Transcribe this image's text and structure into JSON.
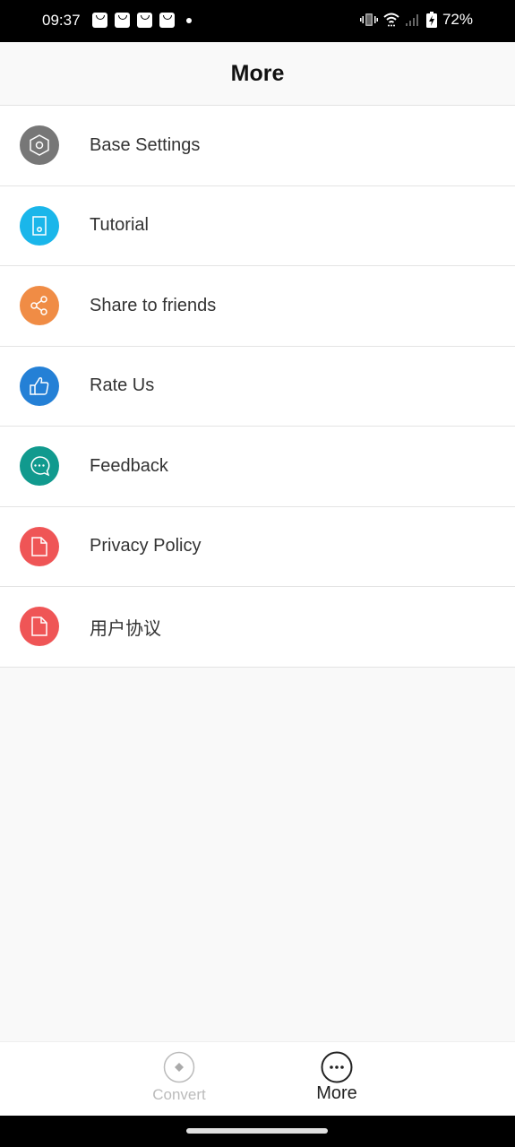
{
  "status_bar": {
    "time": "09:37",
    "notification_icons": [
      "shopping-bag-icon",
      "shopping-bag-icon",
      "shopping-bag-icon",
      "shopping-bag-icon",
      "dot-icon"
    ],
    "battery": "72%"
  },
  "header": {
    "title": "More"
  },
  "menu": {
    "items": [
      {
        "label": "Base Settings",
        "icon": "settings-hexagon-icon",
        "color": "#777777"
      },
      {
        "label": "Tutorial",
        "icon": "tutorial-device-icon",
        "color": "#1ab6ea"
      },
      {
        "label": "Share to friends",
        "icon": "share-icon",
        "color": "#f08c45"
      },
      {
        "label": "Rate Us",
        "icon": "thumbs-up-icon",
        "color": "#2480d6"
      },
      {
        "label": "Feedback",
        "icon": "chat-bubble-icon",
        "color": "#119a8e"
      },
      {
        "label": "Privacy Policy",
        "icon": "document-icon",
        "color": "#ef5556"
      },
      {
        "label": "用户协议",
        "icon": "document-icon",
        "color": "#ef5556"
      }
    ]
  },
  "bottom_nav": {
    "tabs": [
      {
        "label": "Convert",
        "active": false
      },
      {
        "label": "More",
        "active": true
      }
    ]
  }
}
